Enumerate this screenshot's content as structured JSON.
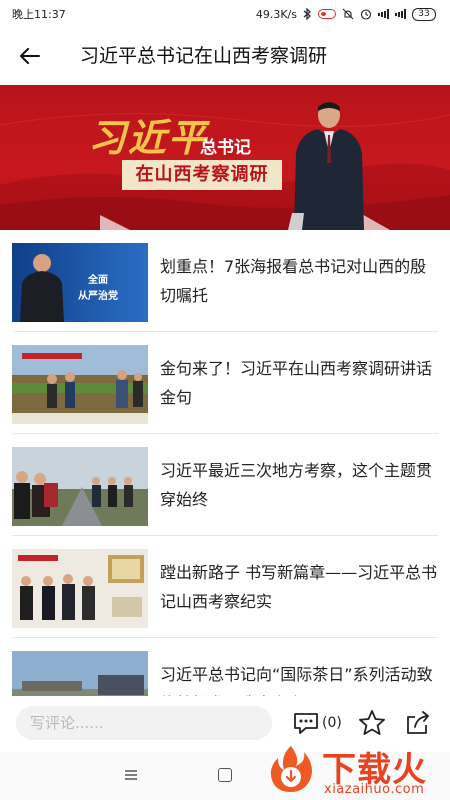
{
  "status_bar": {
    "time": "晚上11:37",
    "net_speed": "49.3K/s",
    "network_type": "4G",
    "battery": "33"
  },
  "header": {
    "back_icon": "arrow-left-icon",
    "title": "习近平总书记在山西考察调研"
  },
  "banner": {
    "name": "习近平",
    "suffix": "总书记",
    "subtitle": "在山西考察调研",
    "colors": {
      "background": "#c8181e",
      "name": "#f3c64a"
    }
  },
  "articles": [
    {
      "title": "划重点！7张海报看总书记对山西的殷切嘱托",
      "thumb_caption": "全面\n从严治党"
    },
    {
      "title": "金句来了！习近平在山西考察调研讲话金句"
    },
    {
      "title": "习近平最近三次地方考察，这个主题贯穿始终"
    },
    {
      "title": "蹚出新路子 书写新篇章——习近平总书记山西考察纪实"
    },
    {
      "title": "习近平总书记向“国际茶日”系列活动致信就新发展我省六上下"
    }
  ],
  "action_bar": {
    "comment_placeholder": "写评论......",
    "comment_count": "(0)",
    "icons": [
      "comment-icon",
      "star-icon",
      "share-icon"
    ]
  },
  "watermark": {
    "text": "下载火",
    "domain": "xiazaihuo.com",
    "color": "#e8421e"
  }
}
